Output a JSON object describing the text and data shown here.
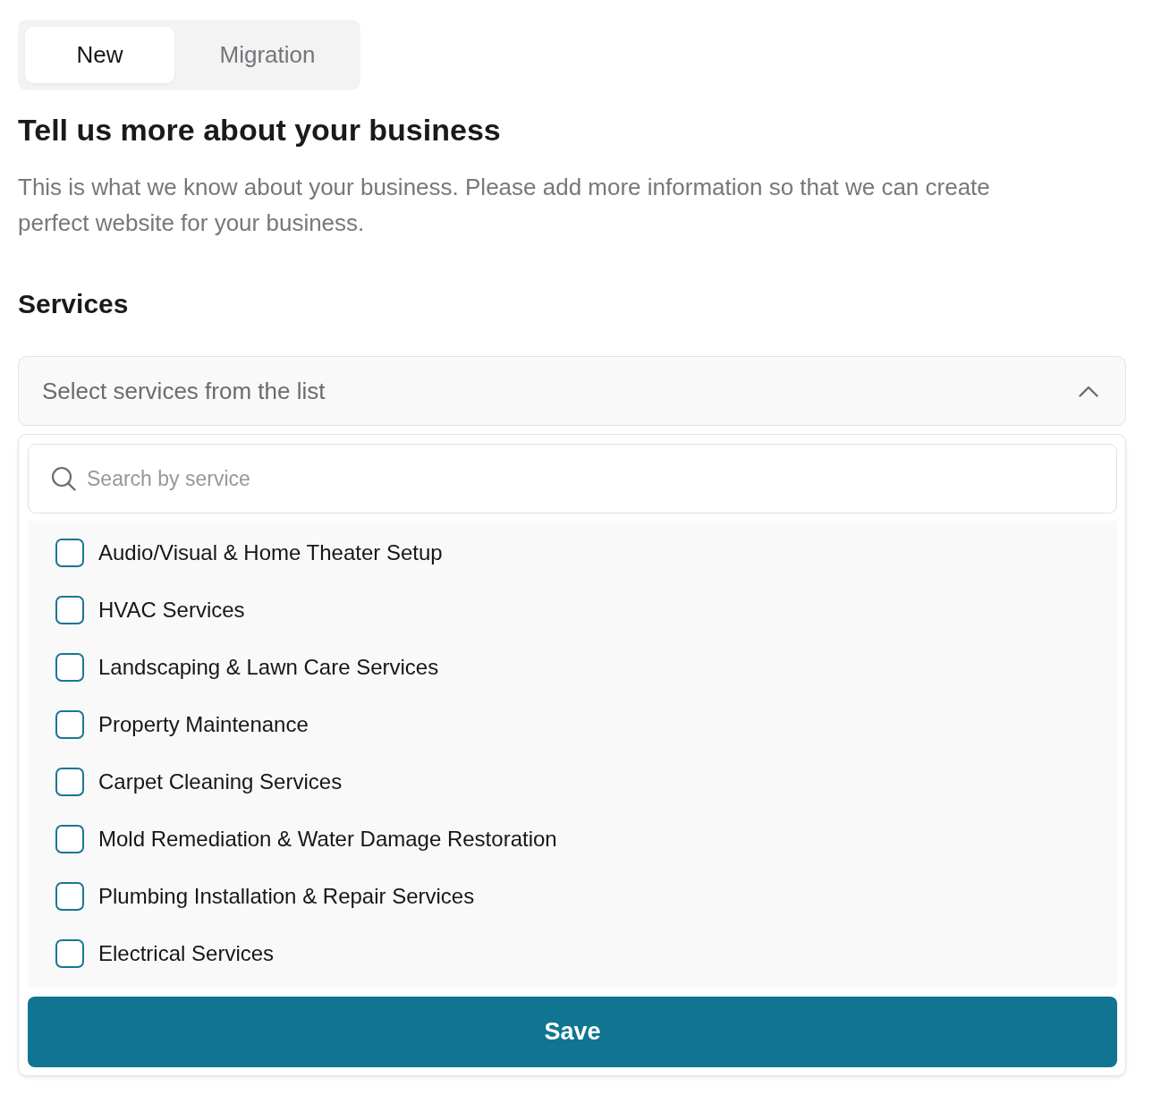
{
  "tabs": [
    {
      "label": "New",
      "selected": true
    },
    {
      "label": "Migration",
      "selected": false
    }
  ],
  "heading": "Tell us more about your business",
  "description": "This is what we know about your business. Please add more information so that we can create perfect website for your business.",
  "services": {
    "title": "Services",
    "select": {
      "placeholder": "Select services from the list",
      "expanded": true
    },
    "search": {
      "placeholder": "Search by service"
    },
    "options": [
      {
        "label": "Audio/Visual & Home Theater Setup",
        "checked": false
      },
      {
        "label": "HVAC Services",
        "checked": false
      },
      {
        "label": "Landscaping & Lawn Care Services",
        "checked": false
      },
      {
        "label": "Property Maintenance",
        "checked": false
      },
      {
        "label": "Carpet Cleaning Services",
        "checked": false
      },
      {
        "label": "Mold Remediation & Water Damage Restoration",
        "checked": false
      },
      {
        "label": "Plumbing Installation & Repair Services",
        "checked": false
      },
      {
        "label": "Electrical Services",
        "checked": false
      }
    ],
    "save_button": "Save"
  }
}
